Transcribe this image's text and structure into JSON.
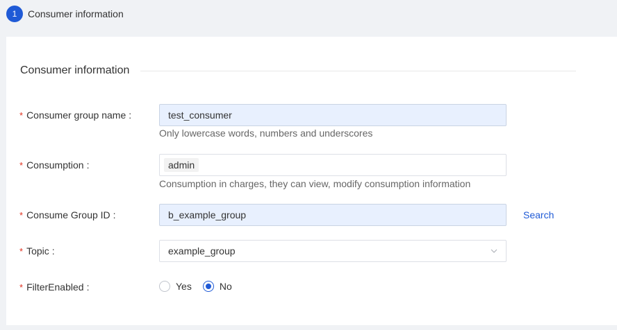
{
  "step": {
    "number": "1",
    "label": "Consumer information"
  },
  "section": {
    "title": "Consumer information"
  },
  "form": {
    "group_name": {
      "label": "Consumer group name",
      "value": "test_consumer",
      "hint": "Only lowercase words, numbers and underscores"
    },
    "consumption": {
      "label": "Consumption",
      "tag": "admin",
      "hint": "Consumption in charges, they can view, modify consumption information"
    },
    "group_id": {
      "label": "Consume Group ID",
      "value": "b_example_group",
      "action": "Search"
    },
    "topic": {
      "label": "Topic",
      "value": "example_group"
    },
    "filter": {
      "label": "FilterEnabled",
      "options": [
        "Yes",
        "No"
      ],
      "selected": "No"
    }
  },
  "common": {
    "required_mark": "*",
    "colon": ":"
  },
  "colors": {
    "accent": "#1f5ad6",
    "required": "#e0301e",
    "filled_bg": "#e8f0fe"
  },
  "icons": {
    "topic_dropdown": "chevron-down-icon"
  }
}
